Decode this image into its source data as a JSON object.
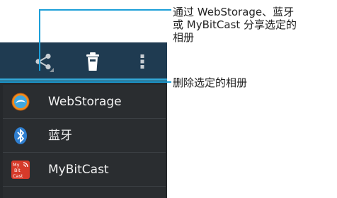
{
  "menu": {
    "items": [
      {
        "label": "WebStorage",
        "icon": "webstorage-icon"
      },
      {
        "label": "蓝牙",
        "icon": "bluetooth-icon"
      },
      {
        "label": "MyBitCast",
        "icon": "mybitcast-icon",
        "icon_text": "My Bit Cast"
      }
    ]
  },
  "action_bar": {
    "icons": [
      "share-icon",
      "delete-icon",
      "overflow-menu-icon"
    ]
  },
  "callouts": {
    "share_line1": "通过 WebStorage、蓝牙",
    "share_line2": "或 MyBitCast 分享选定的",
    "share_line3": "相册",
    "delete": "删除选定的相册"
  },
  "colors": {
    "action_bar": "#1f3b51",
    "accent": "#33a9d9",
    "background": "#25282b"
  }
}
